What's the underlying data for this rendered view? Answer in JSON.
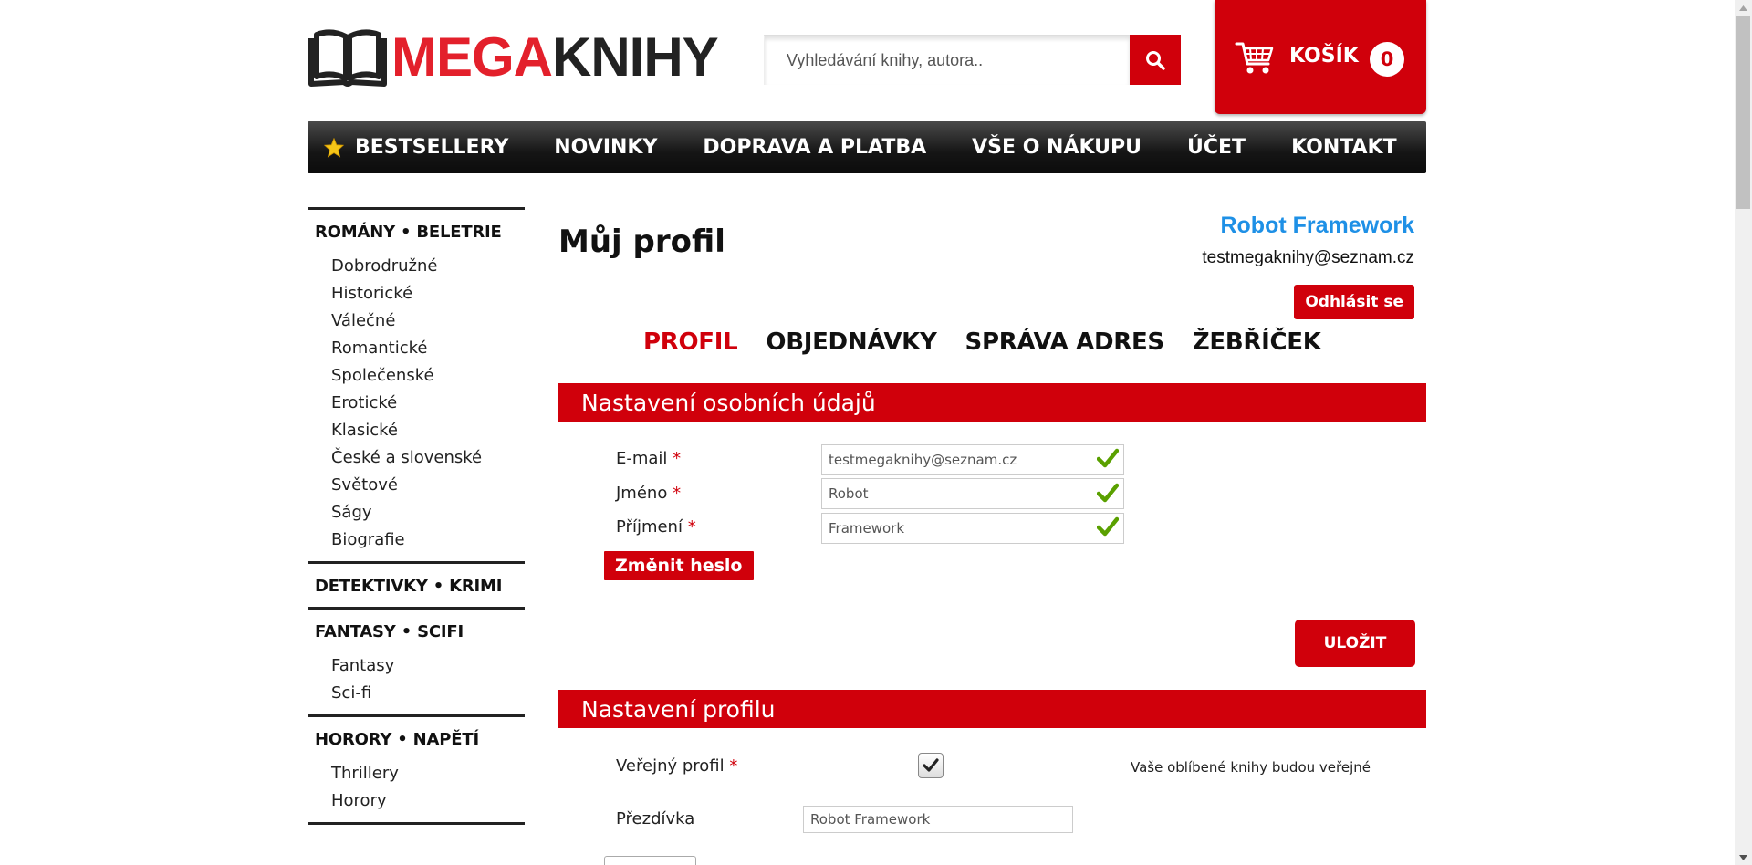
{
  "header": {
    "logo_part1": "MEGA",
    "logo_part2": "KNIHY",
    "search_placeholder": "Vyhledávání knihy, autora..",
    "cart_label": "KOŠÍK",
    "cart_count": "0"
  },
  "nav": {
    "items": [
      {
        "label": "BESTSELLERY",
        "icon": "star-icon"
      },
      {
        "label": "NOVINKY"
      },
      {
        "label": "DOPRAVA A PLATBA"
      },
      {
        "label": "VŠE O NÁKUPU"
      },
      {
        "label": "ÚČET"
      },
      {
        "label": "KONTAKT"
      }
    ]
  },
  "sidebar": {
    "categories": [
      {
        "title": "ROMÁNY • BELETRIE",
        "items": [
          "Dobrodružné",
          "Historické",
          "Válečné",
          "Romantické",
          "Společenské",
          "Erotické",
          "Klasické",
          "České a slovenské",
          "Světové",
          "Ságy",
          "Biografie"
        ]
      },
      {
        "title": "DETEKTIVKY • KRIMI",
        "items": []
      },
      {
        "title": "FANTASY • SCIFI",
        "items": [
          "Fantasy",
          "Sci-fi"
        ]
      },
      {
        "title": "HORORY • NAPĚTÍ",
        "items": [
          "Thrillery",
          "Horory"
        ]
      }
    ]
  },
  "profile": {
    "title": "Můj profil",
    "user_name": "Robot Framework",
    "user_email": "testmegaknihy@seznam.cz",
    "logout_label": "Odhlásit se",
    "tabs": [
      "PROFIL",
      "OBJEDNÁVKY",
      "SPRÁVA ADRES",
      "ŽEBŘÍČEK"
    ],
    "active_tab": "PROFIL",
    "personal_section_title": "Nastavení osobních údajů",
    "fields": {
      "email_label": "E-mail",
      "email_value": "testmegaknihy@seznam.cz",
      "first_name_label": "Jméno",
      "first_name_value": "Robot",
      "last_name_label": "Příjmení",
      "last_name_value": "Framework",
      "required_mark": "*"
    },
    "change_password_label": "Změnit heslo",
    "save_label": "ULOŽIT",
    "profile_section_title": "Nastavení profilu",
    "public_profile_label": "Veřejný profil",
    "public_profile_checked": true,
    "public_profile_note": "Vaše oblíbené knihy budou veřejné",
    "nickname_label": "Přezdívka",
    "nickname_value": "Robot Framework"
  },
  "colors": {
    "brand_red": "#d0000b",
    "user_blue": "#1e90e6",
    "check_green": "#5aa000"
  }
}
